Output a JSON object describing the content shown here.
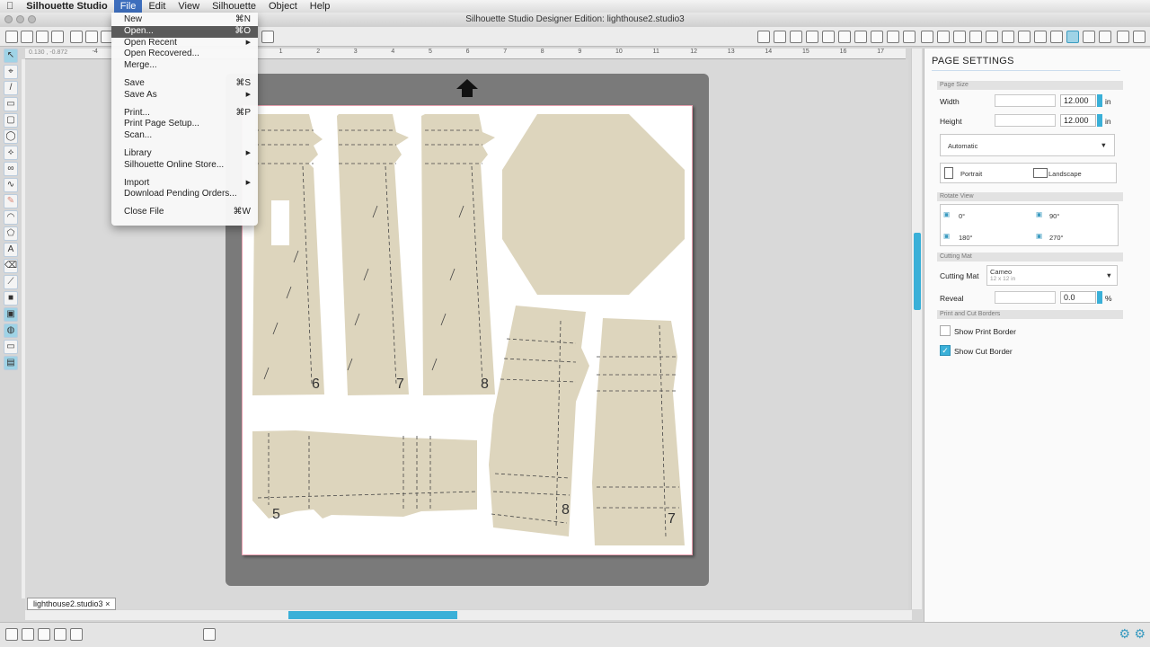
{
  "menubar": {
    "apple": "",
    "app": "Silhouette Studio",
    "items": [
      "File",
      "Edit",
      "View",
      "Silhouette",
      "Object",
      "Help"
    ]
  },
  "window": {
    "title": "Silhouette Studio Designer Edition: lighthouse2.studio3"
  },
  "file_menu": [
    {
      "label": "New",
      "shortcut": "⌘N"
    },
    {
      "label": "Open...",
      "shortcut": "⌘O",
      "highlighted": true
    },
    {
      "label": "Open Recent",
      "submenu": true
    },
    {
      "label": "Open Recovered..."
    },
    {
      "label": "Merge..."
    },
    {
      "sep": true
    },
    {
      "label": "Save",
      "shortcut": "⌘S"
    },
    {
      "label": "Save As",
      "submenu": true
    },
    {
      "sep": true
    },
    {
      "label": "Print...",
      "shortcut": "⌘P"
    },
    {
      "label": "Print Page Setup..."
    },
    {
      "label": "Scan..."
    },
    {
      "sep": true
    },
    {
      "label": "Library",
      "submenu": true
    },
    {
      "label": "Silhouette Online Store..."
    },
    {
      "sep": true
    },
    {
      "label": "Import",
      "submenu": true
    },
    {
      "label": "Download Pending Orders..."
    },
    {
      "sep": true
    },
    {
      "label": "Close File",
      "shortcut": "⌘W"
    }
  ],
  "ruler": {
    "coords": "0.130 , -0.872",
    "ticks": [
      "-4",
      "1",
      "2",
      "3",
      "4",
      "5",
      "6",
      "7",
      "8",
      "9",
      "10",
      "11",
      "12",
      "13",
      "14",
      "15",
      "16",
      "17"
    ]
  },
  "document_tab": "lighthouse2.studio3",
  "page_labels": [
    "6",
    "7",
    "8",
    "5",
    "8",
    "7"
  ],
  "panel": {
    "title": "PAGE SETTINGS",
    "page_size": {
      "section": "Page Size",
      "width_label": "Width",
      "width": "12.000",
      "height_label": "Height",
      "height": "12.000",
      "unit": "in",
      "preset": "Automatic",
      "portrait": "Portrait",
      "landscape": "Landscape"
    },
    "rotate_view": {
      "section": "Rotate View",
      "options": [
        "0°",
        "90°",
        "180°",
        "270°"
      ]
    },
    "cutting_mat": {
      "section": "Cutting Mat",
      "label": "Cutting Mat",
      "value": "Cameo",
      "sub": "12 x 12 in",
      "reveal_label": "Reveal",
      "reveal": "0.0",
      "reveal_unit": "%"
    },
    "borders": {
      "section": "Print and Cut Borders",
      "print_border": "Show Print Border",
      "print_checked": false,
      "cut_border": "Show Cut Border",
      "cut_checked": true
    }
  },
  "colors": {
    "accent": "#3ab0d8",
    "shape": "#ddd5bd",
    "mat": "#7a7a7a"
  }
}
